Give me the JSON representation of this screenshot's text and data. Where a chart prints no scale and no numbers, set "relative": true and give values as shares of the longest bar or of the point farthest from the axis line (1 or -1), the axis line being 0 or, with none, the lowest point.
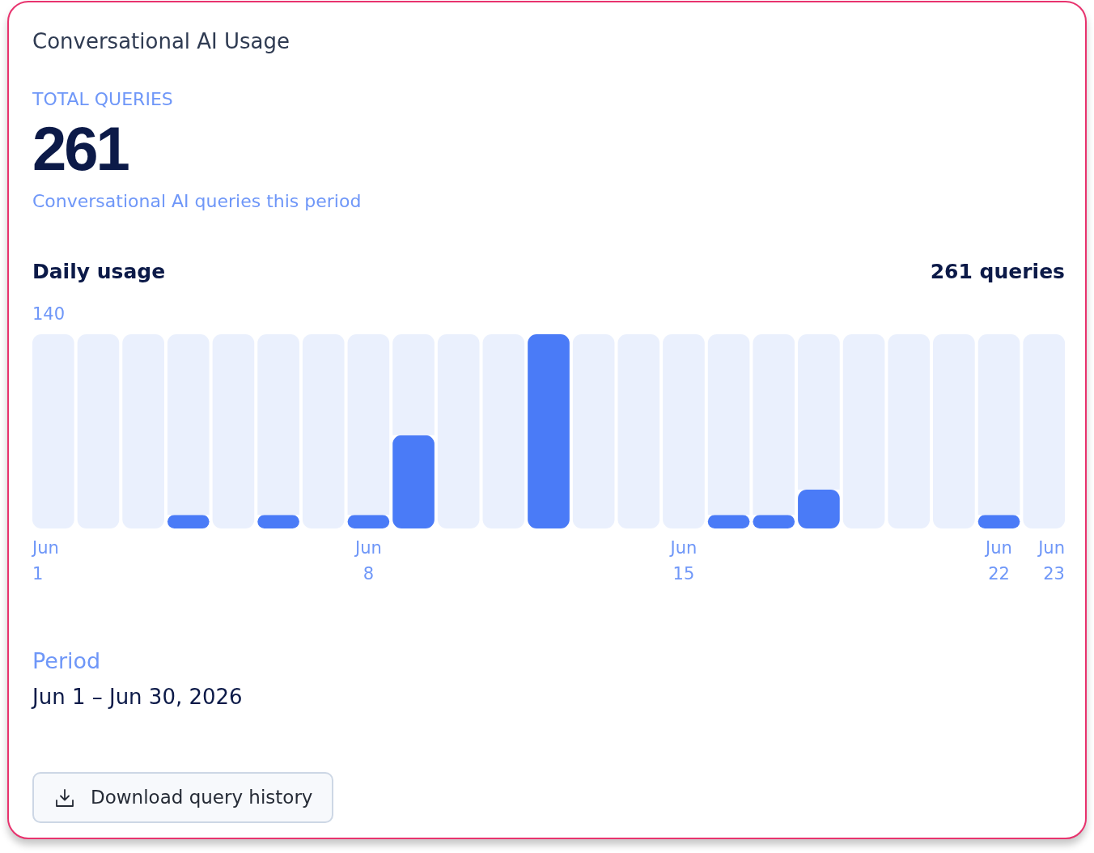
{
  "card": {
    "title": "Conversational AI Usage",
    "stat": {
      "label": "TOTAL QUERIES",
      "value": "261",
      "caption": "Conversational AI queries this period"
    },
    "daily_usage": {
      "title": "Daily usage",
      "total": "261 queries",
      "chart_data": {
        "type": "bar",
        "relative": true,
        "stacked": true,
        "categories": [
          "Jun 1",
          null,
          null,
          null,
          null,
          null,
          null,
          "Jun 8",
          null,
          null,
          null,
          null,
          null,
          null,
          "Jun 15",
          null,
          null,
          null,
          null,
          null,
          null,
          "Jun 22",
          "Jun 23"
        ],
        "series": [
          {
            "color": "#4a7bf7",
            "values": [
              0,
              0,
              0,
              0.07,
              0,
              0.07,
              0,
              0.07,
              0.48,
              0,
              0,
              1,
              0,
              0,
              0,
              0.07,
              0.07,
              0.2,
              0,
              0,
              0,
              0.07,
              0
            ]
          },
          {
            "color": "#eaf0fd",
            "values": [
              1,
              1,
              1,
              0.93,
              1,
              0.93,
              1,
              0.93,
              0.52,
              1,
              1,
              0,
              1,
              1,
              1,
              0.93,
              0.93,
              0.8,
              1,
              1,
              1,
              0.93,
              1
            ]
          }
        ],
        "annotations": [
          {
            "text": "140"
          }
        ]
      }
    },
    "period": {
      "label": "Period",
      "value": "Jun 1 – Jun 30, 2026"
    },
    "download_button": {
      "label": "Download query history"
    }
  }
}
